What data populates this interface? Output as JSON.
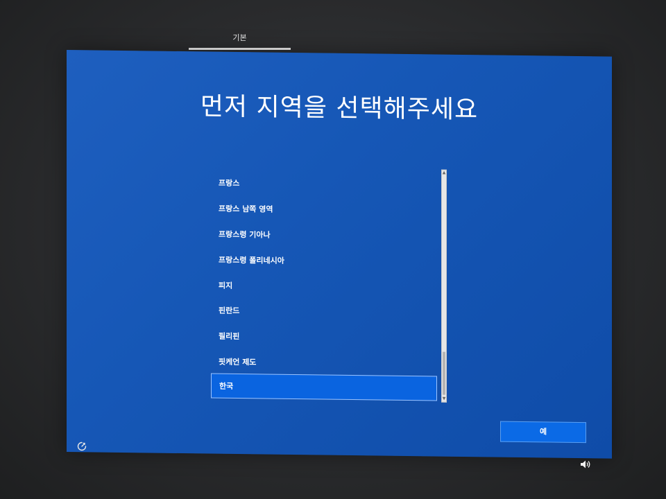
{
  "top_tab": {
    "label": "기본"
  },
  "heading": "먼저 지역을 선택해주세요",
  "region_list": {
    "items": [
      {
        "label": "프랑스"
      },
      {
        "label": "프랑스 남쪽 영역"
      },
      {
        "label": "프랑스령 기아나"
      },
      {
        "label": "프랑스령 폴리네시아"
      },
      {
        "label": "피지"
      },
      {
        "label": "핀란드"
      },
      {
        "label": "필리핀"
      },
      {
        "label": "핏케언 제도"
      },
      {
        "label": "한국"
      }
    ],
    "selected": "한국"
  },
  "buttons": {
    "yes_label": "예"
  },
  "icons": {
    "power": "accessibility-icon",
    "volume": "volume-icon",
    "scroll_up": "chevron-up-icon",
    "scroll_down": "chevron-down-icon"
  },
  "colors": {
    "screen_bg": "#1657b6",
    "selected_item": "#0a64e0",
    "button_bg": "#0b6ae6"
  }
}
